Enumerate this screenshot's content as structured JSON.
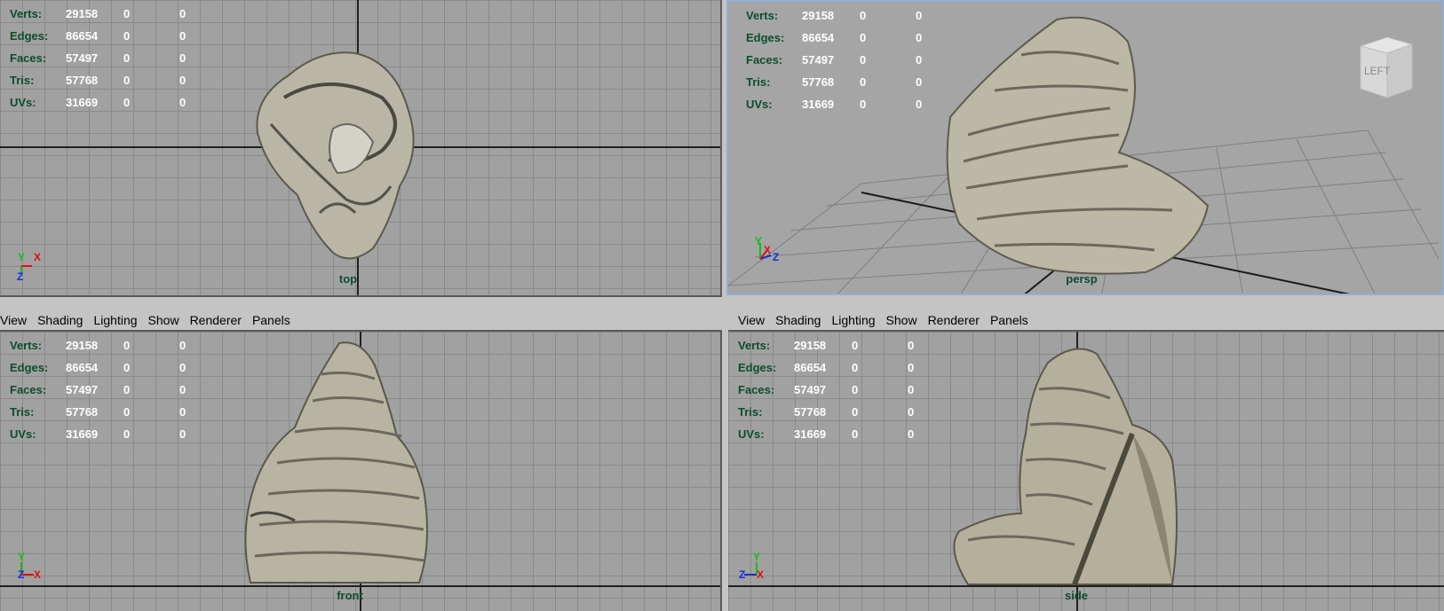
{
  "stats": [
    {
      "label": "Verts:",
      "value": "29158",
      "sel": "0",
      "extra": "0"
    },
    {
      "label": "Edges:",
      "value": "86654",
      "sel": "0",
      "extra": "0"
    },
    {
      "label": "Faces:",
      "value": "57497",
      "sel": "0",
      "extra": "0"
    },
    {
      "label": "Tris:",
      "value": "57768",
      "sel": "0",
      "extra": "0"
    },
    {
      "label": "UVs:",
      "value": "31669",
      "sel": "0",
      "extra": "0"
    }
  ],
  "viewports": {
    "top": {
      "camera": "top"
    },
    "persp": {
      "camera": "persp",
      "viewcube_face": "LEFT"
    },
    "front": {
      "camera": "front"
    },
    "side": {
      "camera": "side"
    }
  },
  "menu": [
    "View",
    "Shading",
    "Lighting",
    "Show",
    "Renderer",
    "Panels"
  ],
  "axes": {
    "x": "X",
    "y": "Y",
    "z": "Z"
  },
  "colors": {
    "grid_bg": "#a1a1a1",
    "grid_line": "#8a8a8a",
    "label_green": "#0d4d2c",
    "axis_x": "#e01010",
    "axis_y": "#10c010",
    "axis_z": "#1030e0",
    "active_border": "#8fb0d6"
  }
}
